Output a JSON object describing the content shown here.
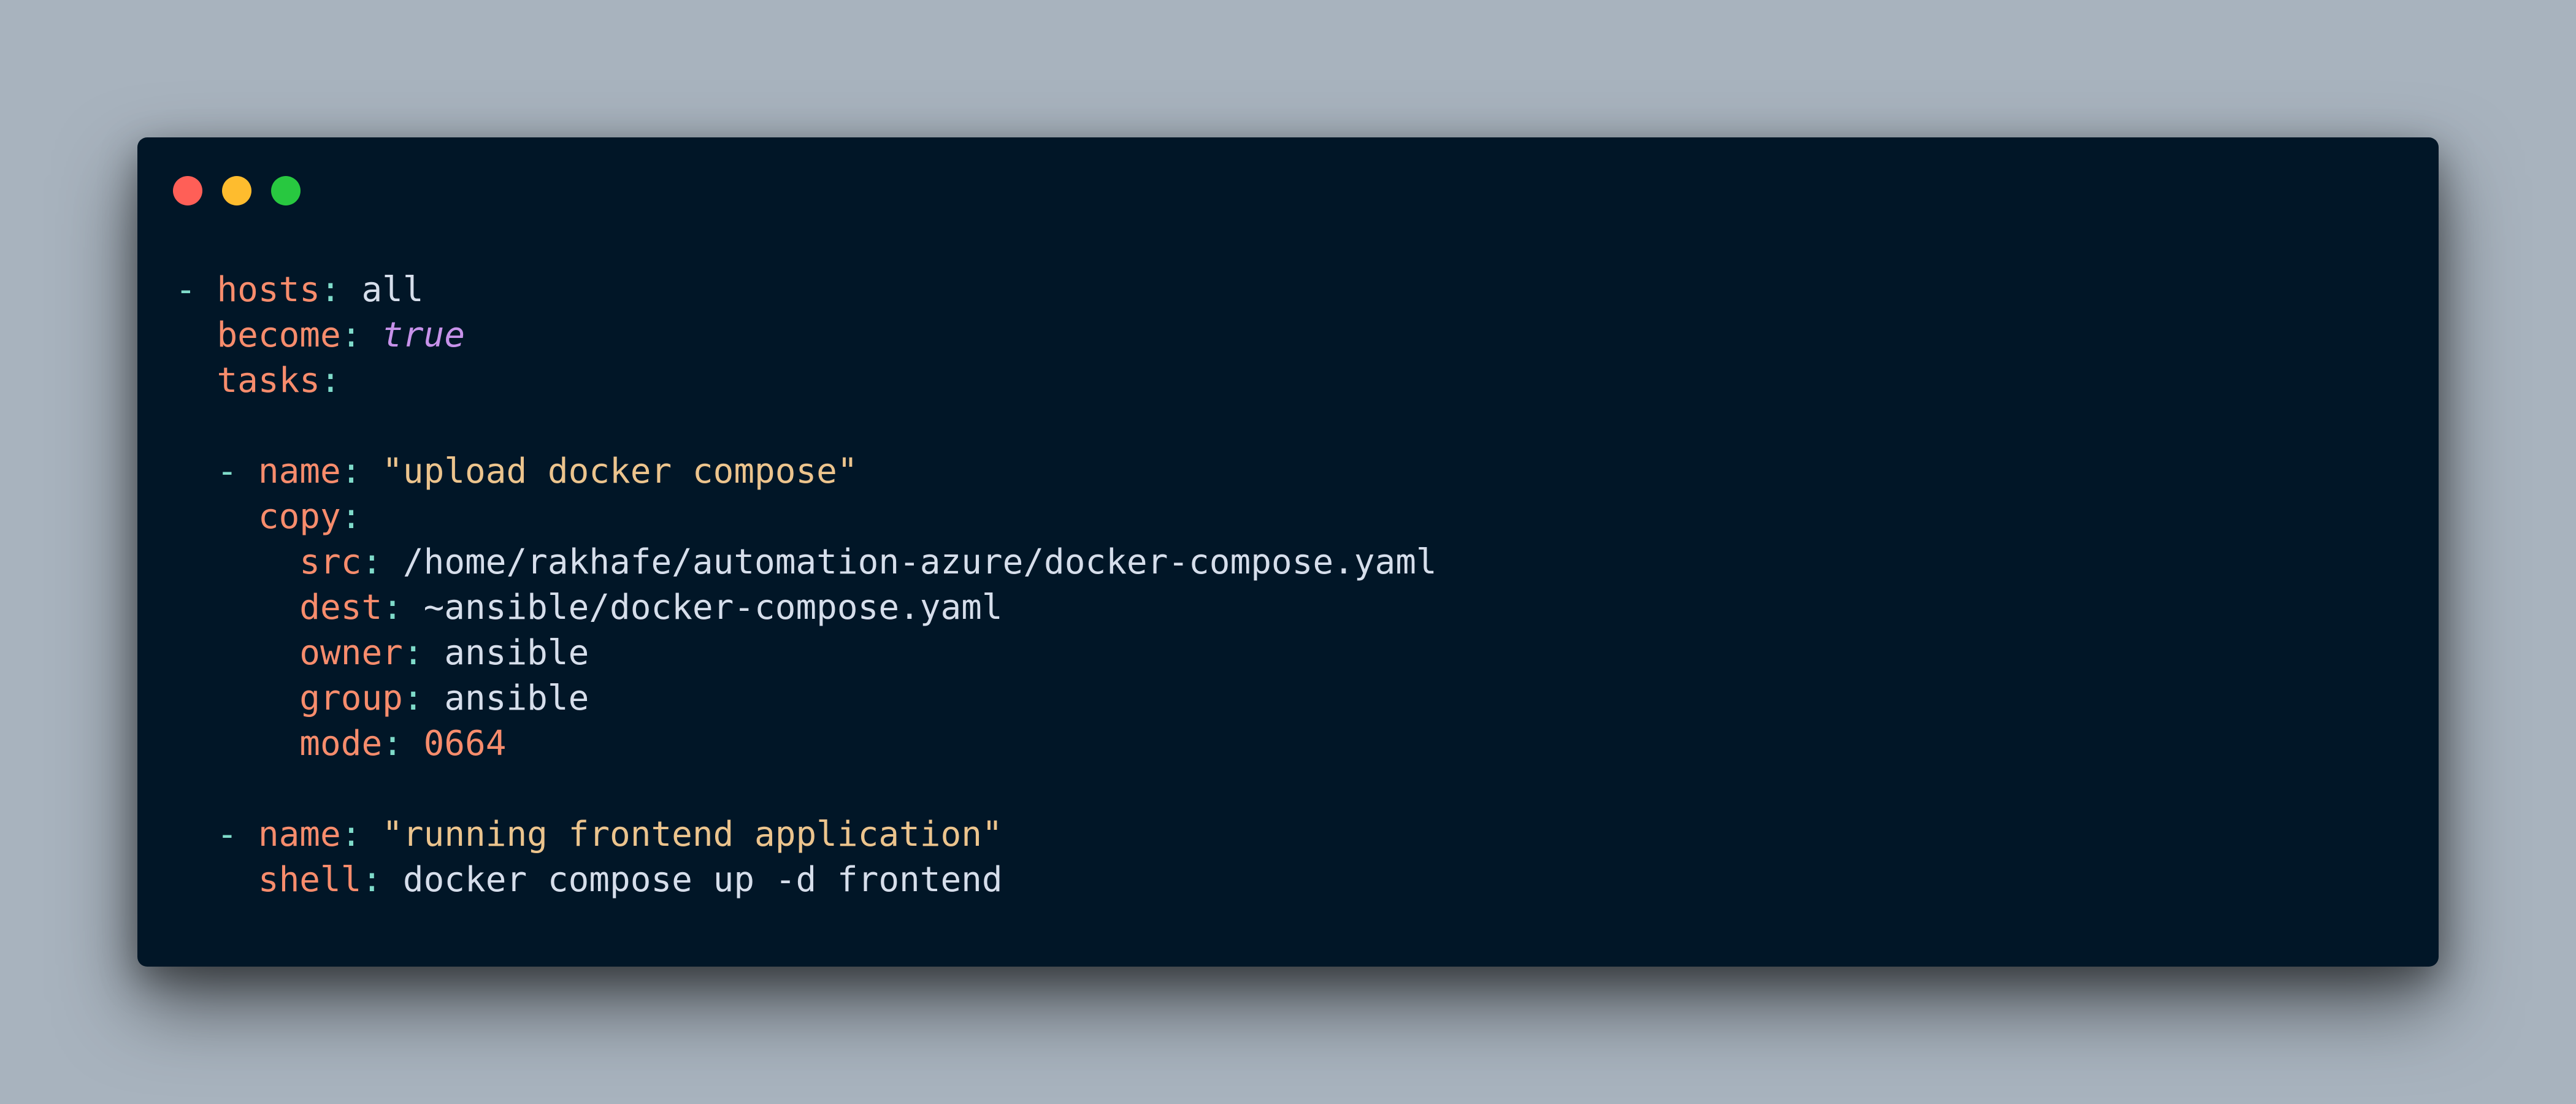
{
  "window": {
    "background": "#011627",
    "controls": [
      {
        "name": "close",
        "color": "#ff5f57"
      },
      {
        "name": "minimize",
        "color": "#febc2e"
      },
      {
        "name": "maximize",
        "color": "#28c840"
      }
    ]
  },
  "syntax_colors": {
    "key": "#f78c6c",
    "punctuation": "#7fdbca",
    "plain": "#d6deeb",
    "string": "#ecc48d",
    "boolean": "#c792ea",
    "number": "#f78c6c"
  },
  "code": {
    "language": "yaml",
    "l1": {
      "dash": "- ",
      "key": "hosts",
      "colon": ": ",
      "value": "all"
    },
    "l2": {
      "indent": "  ",
      "key": "become",
      "colon": ": ",
      "value": "true"
    },
    "l3": {
      "indent": "  ",
      "key": "tasks",
      "colon": ":"
    },
    "l5": {
      "indent": "  ",
      "dash": "- ",
      "key": "name",
      "colon": ": ",
      "value": "\"upload docker compose\""
    },
    "l6": {
      "indent": "    ",
      "key": "copy",
      "colon": ":"
    },
    "l7": {
      "indent": "      ",
      "key": "src",
      "colon": ": ",
      "value": "/home/rakhafe/automation-azure/docker-compose.yaml"
    },
    "l8": {
      "indent": "      ",
      "key": "dest",
      "colon": ": ",
      "value": "~ansible/docker-compose.yaml"
    },
    "l9": {
      "indent": "      ",
      "key": "owner",
      "colon": ": ",
      "value": "ansible"
    },
    "l10": {
      "indent": "      ",
      "key": "group",
      "colon": ": ",
      "value": "ansible"
    },
    "l11": {
      "indent": "      ",
      "key": "mode",
      "colon": ": ",
      "value": "0664"
    },
    "l13": {
      "indent": "  ",
      "dash": "- ",
      "key": "name",
      "colon": ": ",
      "value": "\"running frontend application\""
    },
    "l14": {
      "indent": "    ",
      "key": "shell",
      "colon": ": ",
      "value": "docker compose up -d frontend"
    }
  }
}
